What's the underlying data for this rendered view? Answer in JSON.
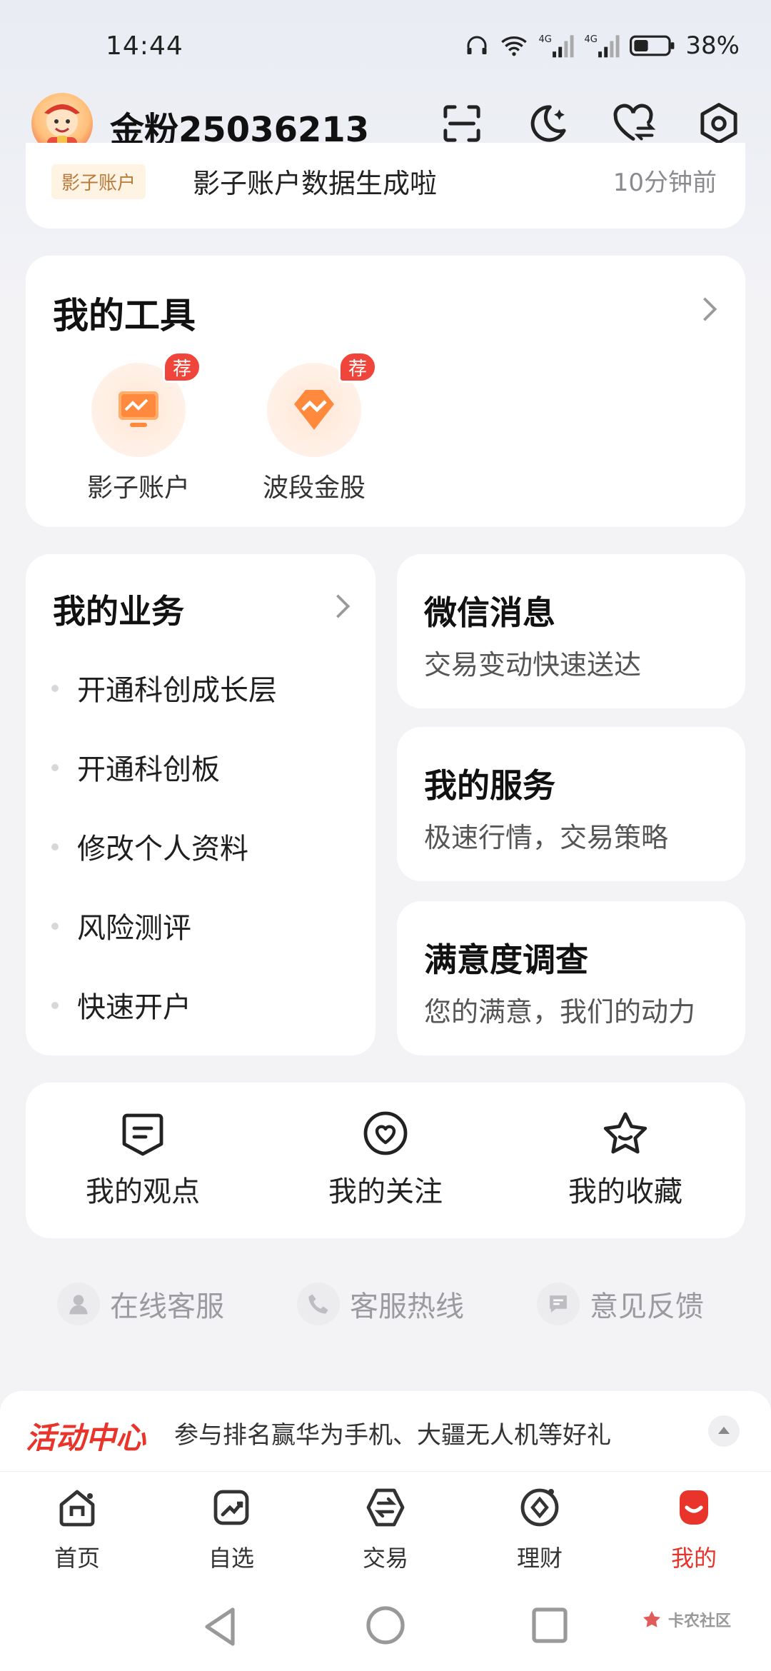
{
  "status_bar": {
    "time": "14:44",
    "battery": "38%",
    "network": "4G"
  },
  "header": {
    "username": "金粉25036213",
    "icons": [
      "scan-icon",
      "moon-icon",
      "heart-swap-icon",
      "settings-icon"
    ]
  },
  "notice": {
    "tag": "影子账户",
    "text": "影子账户数据生成啦",
    "time": "10分钟前"
  },
  "tools": {
    "title": "我的工具",
    "items": [
      {
        "label": "影子账户",
        "badge": "荐"
      },
      {
        "label": "波段金股",
        "badge": "荐"
      }
    ]
  },
  "business": {
    "title": "我的业务",
    "items": [
      "开通科创成长层",
      "开通科创板",
      "修改个人资料",
      "风险测评",
      "快速开户"
    ]
  },
  "side_cards": [
    {
      "title": "微信消息",
      "subtitle": "交易变动快速送达"
    },
    {
      "title": "我的服务",
      "subtitle": "极速行情，交易策略"
    },
    {
      "title": "满意度调查",
      "subtitle": "您的满意，我们的动力"
    }
  ],
  "quick_actions": [
    {
      "label": "我的观点",
      "icon": "comment-icon"
    },
    {
      "label": "我的关注",
      "icon": "heart-circle-icon"
    },
    {
      "label": "我的收藏",
      "icon": "star-icon"
    }
  ],
  "support": [
    {
      "label": "在线客服",
      "icon": "agent-icon"
    },
    {
      "label": "客服热线",
      "icon": "phone-icon"
    },
    {
      "label": "意见反馈",
      "icon": "feedback-icon"
    }
  ],
  "activity": {
    "brand": "活动中心",
    "text": "参与排名赢华为手机、大疆无人机等好礼"
  },
  "tabs": [
    {
      "label": "首页",
      "icon": "home-icon",
      "active": false
    },
    {
      "label": "自选",
      "icon": "watchlist-icon",
      "active": false
    },
    {
      "label": "交易",
      "icon": "trade-icon",
      "active": false
    },
    {
      "label": "理财",
      "icon": "wealth-icon",
      "active": false
    },
    {
      "label": "我的",
      "icon": "profile-icon",
      "active": true
    }
  ],
  "watermark": "卡农社区",
  "colors": {
    "accent": "#e8342b",
    "badge": "#f0453a",
    "background": "#f3f3f6"
  }
}
